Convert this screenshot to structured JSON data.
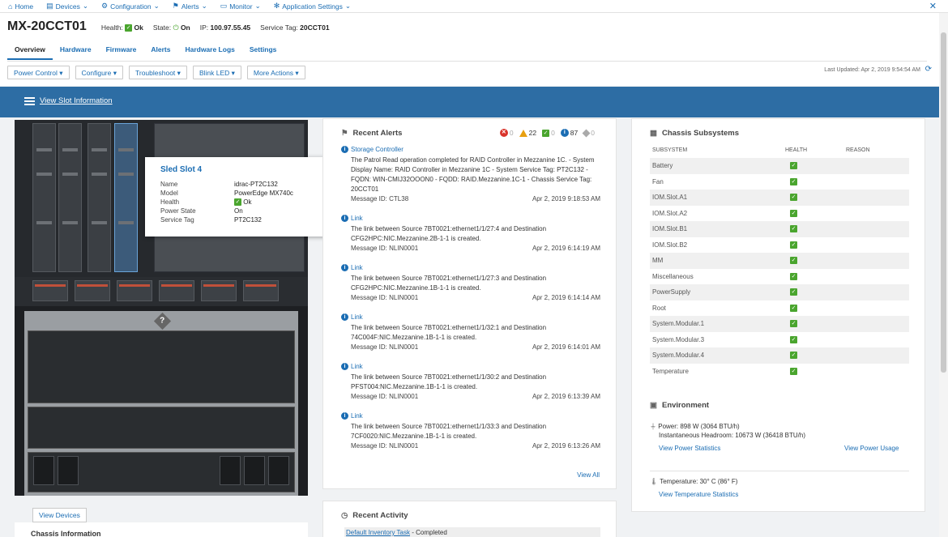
{
  "topnav": {
    "items": [
      {
        "label": "Home",
        "icon": "home-icon"
      },
      {
        "label": "Devices",
        "icon": "devices-icon"
      },
      {
        "label": "Configuration",
        "icon": "configuration-icon"
      },
      {
        "label": "Alerts",
        "icon": "alerts-icon"
      },
      {
        "label": "Monitor",
        "icon": "monitor-icon"
      },
      {
        "label": "Application Settings",
        "icon": "gear-icon"
      }
    ]
  },
  "header": {
    "title": "MX-20CCT01",
    "health_label": "Health:",
    "health_value": "Ok",
    "state_label": "State:",
    "state_value": "On",
    "ip_label": "IP:",
    "ip_value": "100.97.55.45",
    "service_tag_label": "Service Tag:",
    "service_tag_value": "20CCT01"
  },
  "tabs": [
    "Overview",
    "Hardware",
    "Firmware",
    "Alerts",
    "Hardware Logs",
    "Settings"
  ],
  "actions": [
    "Power Control",
    "Configure",
    "Troubleshoot",
    "Blink LED",
    "More Actions"
  ],
  "last_updated": "Last Updated: Apr 2, 2019 9:54:54 AM",
  "banner": {
    "link": "View Slot Information"
  },
  "tooltip": {
    "title": "Sled Slot 4",
    "rows": [
      {
        "key": "Name",
        "value": "idrac-PT2C132"
      },
      {
        "key": "Model",
        "value": "PowerEdge MX740c"
      },
      {
        "key": "Health",
        "value": "Ok"
      },
      {
        "key": "Power State",
        "value": "On"
      },
      {
        "key": "Service Tag",
        "value": "PT2C132"
      }
    ]
  },
  "view_devices": "View Devices",
  "chassis_information": "Chassis Information",
  "recent_alerts": {
    "title": "Recent Alerts",
    "counts": {
      "critical": "0",
      "warning": "22",
      "ok": "0",
      "info": "87",
      "unknown": "0"
    },
    "items": [
      {
        "title": "Storage Controller",
        "desc": "The Patrol Read operation completed for RAID Controller in Mezzanine 1C. - System Display Name: RAID Controller in Mezzanine 1C - System Service Tag: PT2C132 - FQDN: WIN-CMIJ32OOON0 - FQDD: RAID.Mezzanine.1C-1 - Chassis Service Tag: 20CCT01",
        "msg": "Message ID: CTL38",
        "time": "Apr 2, 2019 9:18:53 AM"
      },
      {
        "title": "Link",
        "desc": "The link between Source 7BT0021:ethernet1/1/27:4 and Destination CFG2HPC:NIC.Mezzanine.2B-1-1 is created.",
        "msg": "Message ID: NLIN0001",
        "time": "Apr 2, 2019 6:14:19 AM"
      },
      {
        "title": "Link",
        "desc": "The link between Source 7BT0021:ethernet1/1/27:3 and Destination CFG2HPC:NIC.Mezzanine.1B-1-1 is created.",
        "msg": "Message ID: NLIN0001",
        "time": "Apr 2, 2019 6:14:14 AM"
      },
      {
        "title": "Link",
        "desc": "The link between Source 7BT0021:ethernet1/1/32:1 and Destination 74C004F:NIC.Mezzanine.1B-1-1 is created.",
        "msg": "Message ID: NLIN0001",
        "time": "Apr 2, 2019 6:14:01 AM"
      },
      {
        "title": "Link",
        "desc": "The link between Source 7BT0021:ethernet1/1/30:2 and Destination PFST004:NIC.Mezzanine.1B-1-1 is created.",
        "msg": "Message ID: NLIN0001",
        "time": "Apr 2, 2019 6:13:39 AM"
      },
      {
        "title": "Link",
        "desc": "The link between Source 7BT0021:ethernet1/1/33:3 and Destination 7CF0020:NIC.Mezzanine.1B-1-1 is created.",
        "msg": "Message ID: NLIN0001",
        "time": "Apr 2, 2019 6:13:26 AM"
      }
    ],
    "view_all": "View All"
  },
  "recent_activity": {
    "title": "Recent Activity",
    "task": "Default Inventory Task",
    "status": " - Completed"
  },
  "subsystems": {
    "title": "Chassis Subsystems",
    "columns": [
      "SUBSYSTEM",
      "HEALTH",
      "REASON"
    ],
    "rows": [
      "Battery",
      "Fan",
      "IOM.Slot.A1",
      "IOM.Slot.A2",
      "IOM.Slot.B1",
      "IOM.Slot.B2",
      "MM",
      "Miscellaneous",
      "PowerSupply",
      "Root",
      "System.Modular.1",
      "System.Modular.3",
      "System.Modular.4",
      "Temperature"
    ]
  },
  "environment": {
    "title": "Environment",
    "power": "Power: 898 W (3064 BTU/h)",
    "headroom": "Instantaneous Headroom: 10673 W (36418 BTU/h)",
    "view_power_stats": "View Power Statistics",
    "view_power_usage": "View Power Usage",
    "temperature": "Temperature: 30° C (86° F)",
    "view_temp_stats": "View Temperature Statistics"
  },
  "colors": {
    "accent": "#1b6db3",
    "banner": "#2d6da4",
    "ok": "#4aa52e",
    "critical": "#d9342b",
    "warning": "#e8a010"
  }
}
